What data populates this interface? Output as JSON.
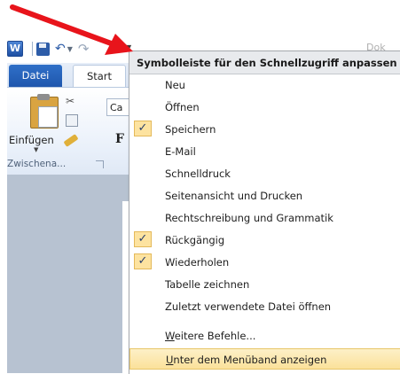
{
  "app": {
    "logo_letter": "W",
    "title_fragment": "Dok"
  },
  "tabs": {
    "file_label": "Datei",
    "start_label": "Start"
  },
  "ribbon": {
    "paste_label": "Einfügen",
    "font_name": "Ca",
    "bold_glyph": "F",
    "clipboard_group_label": "Zwischena..."
  },
  "menu": {
    "header": "Symbolleiste für den Schnellzugriff anpassen",
    "check_glyph": "✓",
    "items": [
      {
        "label": "Neu",
        "checked": false
      },
      {
        "label": "Öffnen",
        "checked": false
      },
      {
        "label": "Speichern",
        "checked": true
      },
      {
        "label": "E-Mail",
        "checked": false
      },
      {
        "label": "Schnelldruck",
        "checked": false
      },
      {
        "label": "Seitenansicht und Drucken",
        "checked": false
      },
      {
        "label": "Rechtschreibung und Grammatik",
        "checked": false
      },
      {
        "label": "Rückgängig",
        "checked": true
      },
      {
        "label": "Wiederholen",
        "checked": true
      },
      {
        "label": "Tabelle zeichnen",
        "checked": false
      },
      {
        "label": "Zuletzt verwendete Datei öffnen",
        "checked": false
      }
    ],
    "more_commands": {
      "first": "W",
      "rest": "eitere Befehle..."
    },
    "show_below": {
      "first": "U",
      "rest": "nter dem Menüband anzeigen"
    }
  },
  "colors": {
    "annotation_arrow": "#e8141b",
    "highlight": "#fbe19a",
    "file_tab": "#2f70c8"
  }
}
